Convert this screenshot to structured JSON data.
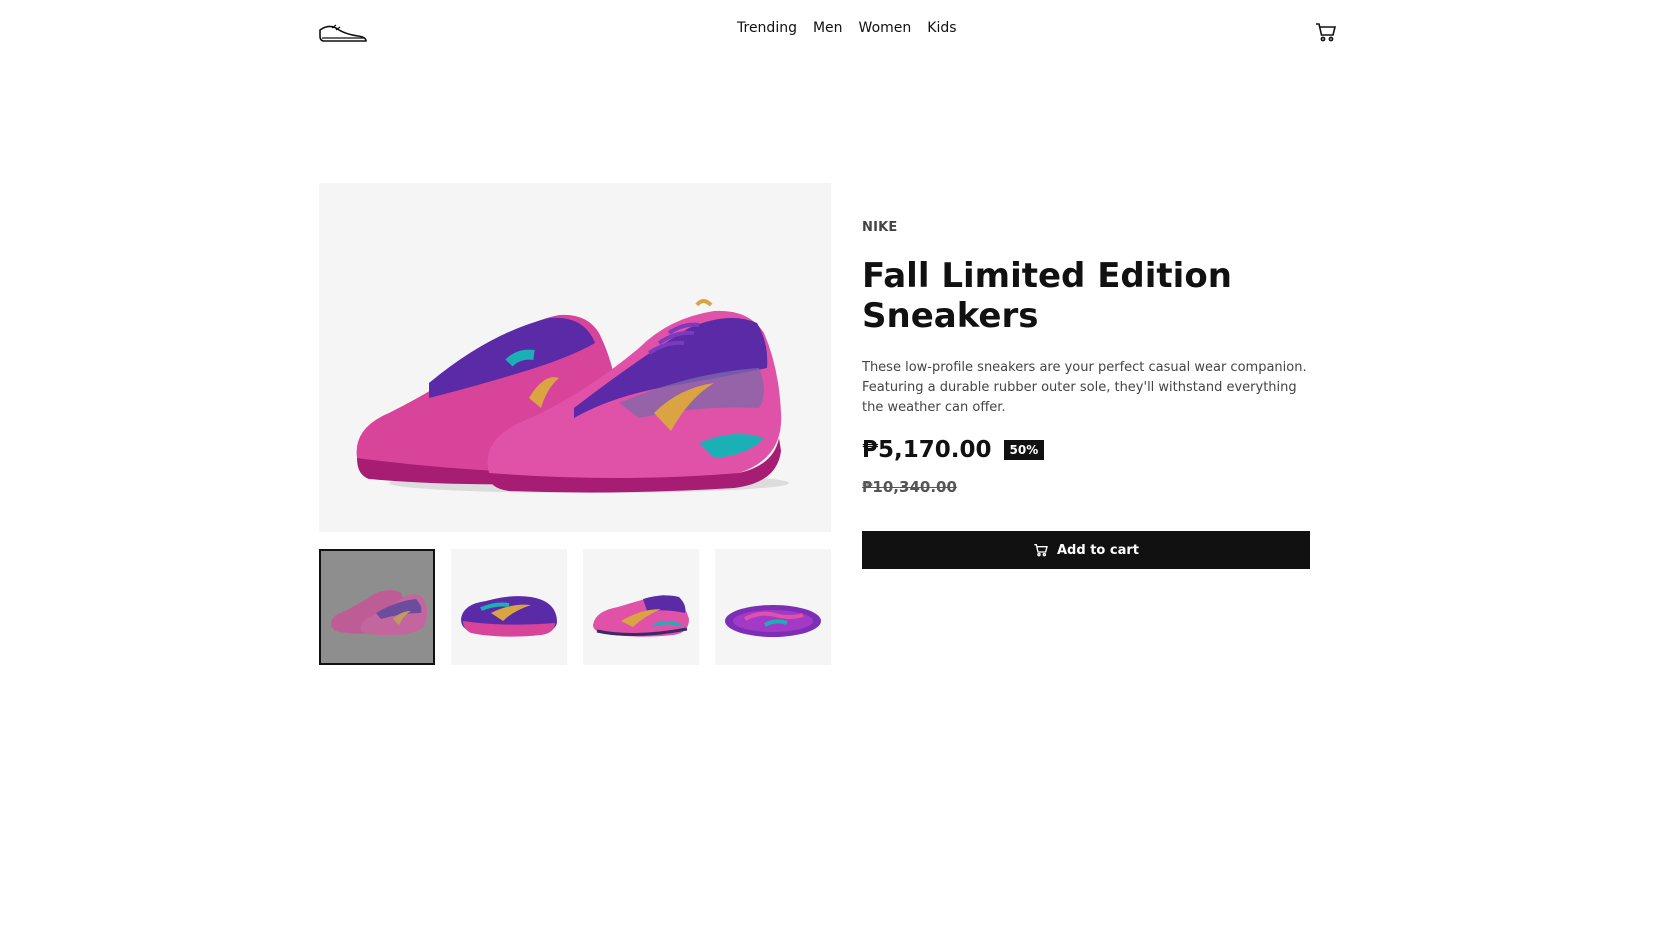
{
  "header": {
    "logo_icon": "sneaker-logo-icon",
    "nav": [
      "Trending",
      "Men",
      "Women",
      "Kids"
    ],
    "cart_icon": "cart-icon"
  },
  "product": {
    "brand": "NIKE",
    "title": "Fall Limited Edition Sneakers",
    "description": "These low-profile sneakers are your perfect casual wear companion. Featuring a durable rubber outer sole, they'll withstand everything the weather can offer.",
    "price": "₱5,170.00",
    "discount": "50%",
    "original_price": "₱10,340.00",
    "add_to_cart_label": "Add to cart"
  },
  "gallery": {
    "selected_index": 0,
    "thumbnail_count": 4
  },
  "colors": {
    "accent": "#111111",
    "shoe_pink": "#d8449a",
    "shoe_purple": "#5b2aa6",
    "swoosh_gold": "#d9a441",
    "teal": "#1bb0b5"
  }
}
